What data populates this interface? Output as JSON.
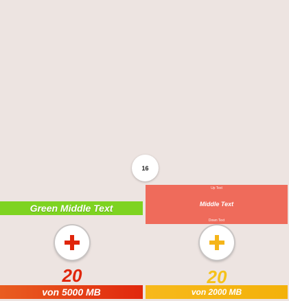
{
  "badge": {
    "value": "16"
  },
  "left_card": {
    "green_label": "Green Middle Text",
    "value": "20",
    "footer": "von 5000 MB",
    "accent_color": "#e0250b",
    "plus_icon": "plus-icon"
  },
  "right_card": {
    "up_text": "Up Text",
    "middle_text": "Middle Text",
    "down_text": "Down Text",
    "value": "20",
    "footer": "von 2000 MB",
    "accent_color": "#f5c21a",
    "plus_icon": "plus-icon"
  },
  "colors": {
    "background": "#ede4e1",
    "green": "#7ed321",
    "red_panel": "#ef6b5b",
    "orange_red": "#e1280d",
    "yellow": "#f5c21a"
  }
}
